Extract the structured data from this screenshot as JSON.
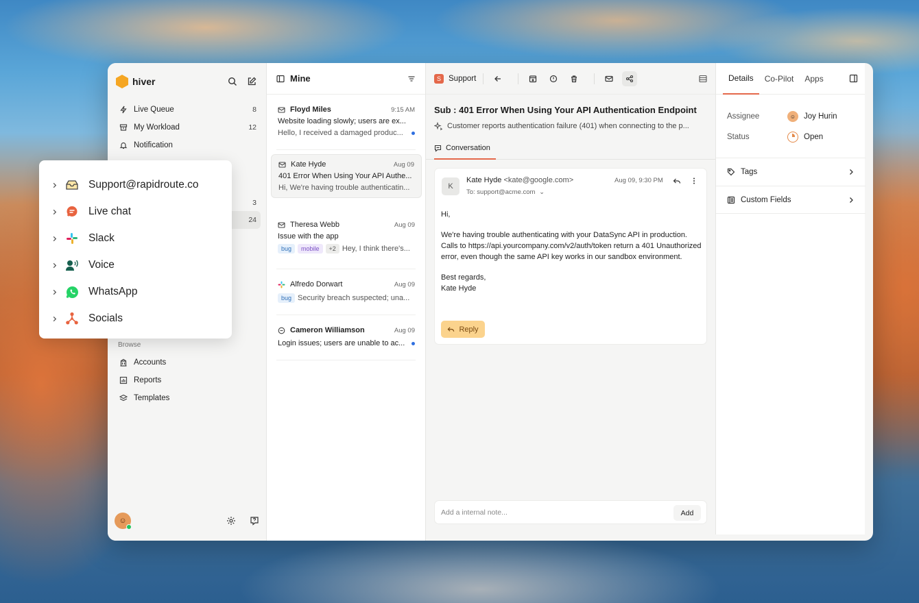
{
  "app": {
    "logo_text": "hiver"
  },
  "sidebar": {
    "items": [
      {
        "label": "Live Queue",
        "count": "8",
        "icon": "bolt-icon"
      },
      {
        "label": "My Workload",
        "count": "12",
        "icon": "inbox-stack-icon"
      },
      {
        "label": "Notification",
        "count": "",
        "icon": "bell-icon"
      }
    ],
    "hidden_counts": [
      "3",
      "24"
    ],
    "browse_label": "Browse",
    "browse_items": [
      {
        "label": "Accounts",
        "icon": "building-icon"
      },
      {
        "label": "Reports",
        "icon": "chart-icon"
      },
      {
        "label": "Templates",
        "icon": "layers-icon"
      }
    ]
  },
  "popup": {
    "items": [
      {
        "label": "Support@rapidroute.co",
        "icon": "inbox-tray-icon"
      },
      {
        "label": "Live chat",
        "icon": "chat-bubble-icon"
      },
      {
        "label": "Slack",
        "icon": "slack-icon"
      },
      {
        "label": "Voice",
        "icon": "voice-icon"
      },
      {
        "label": "WhatsApp",
        "icon": "whatsapp-icon"
      },
      {
        "label": "Socials",
        "icon": "socials-icon"
      }
    ]
  },
  "list": {
    "title": "Mine",
    "items": [
      {
        "name": "Floyd Miles",
        "time": "9:15 AM",
        "subject": "Website loading slowly; users are ex...",
        "preview": "Hello, I received a damaged produc...",
        "unread": true
      },
      {
        "name": "Kate Hyde",
        "time": "Aug 09",
        "subject": "401 Error When Using Your API Authe...",
        "preview": "Hi, We're having trouble authenticatin...",
        "unread": false
      },
      {
        "name": "Theresa Webb",
        "time": "Aug 09",
        "subject": "Issue with the app",
        "tags": [
          "bug",
          "mobile",
          "+2"
        ],
        "preview": "Hey, I think there's...",
        "unread": false
      },
      {
        "name": "Alfredo Dorwart",
        "time": "Aug 09",
        "tags": [
          "bug"
        ],
        "preview": "Security breach suspected; una...",
        "unread": false
      },
      {
        "name": "Cameron Williamson",
        "time": "Aug 09",
        "subject": "Login issues; users are unable to ac...",
        "unread": true
      }
    ]
  },
  "conversation": {
    "inbox": "Support",
    "subject": "Sub : 401 Error When Using Your API Authentication Endpoint",
    "summary": "Customer reports authentication failure (401) when connecting to the p...",
    "tab": "Conversation",
    "message": {
      "avatar": "K",
      "from_name": "Kate Hyde",
      "from_email": "<kate@google.com>",
      "to": "To: support@acme.com",
      "date": "Aug 09, 9:30 PM",
      "greeting": "Hi,",
      "body": "We're having trouble authenticating with your DataSync API in production. Calls to https://api.yourcompany.com/v2/auth/token return a 401 Unauthorized error, even though the same API key works in our sandbox environment.",
      "signoff": "Best regards,",
      "signature": "Kate Hyde"
    },
    "reply_label": "Reply",
    "note_placeholder": "Add a internal note...",
    "add_label": "Add"
  },
  "details": {
    "tabs": [
      "Details",
      "Co-Pilot",
      "Apps"
    ],
    "assignee_label": "Assignee",
    "assignee": "Joy Hurin",
    "status_label": "Status",
    "status": "Open",
    "tags_label": "Tags",
    "custom_fields_label": "Custom Fields"
  },
  "colors": {
    "accent": "#e4684a",
    "reply": "#fbd38d",
    "unread_dot": "#2f6fe0"
  }
}
